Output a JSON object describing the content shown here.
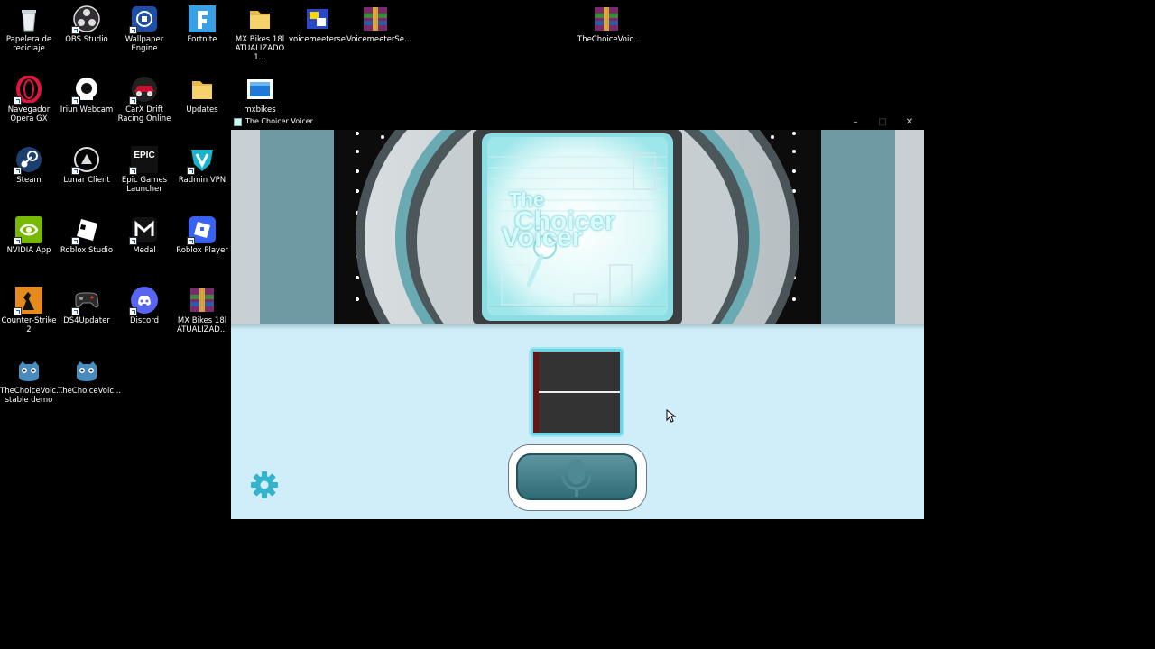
{
  "desktop": {
    "icons": [
      {
        "label": "Papelera de reciclaje",
        "icon": "recycle-bin-icon"
      },
      {
        "label": "OBS Studio",
        "icon": "obs-icon"
      },
      {
        "label": "Wallpaper Engine",
        "icon": "wallpaper-engine-icon"
      },
      {
        "label": "Fortnite",
        "icon": "fortnite-icon"
      },
      {
        "label": "MX Bikes 18l ATUALIZADO 1...",
        "icon": "folder-icon"
      },
      {
        "label": "voicemeeterse...",
        "icon": "voicemeeter-icon"
      },
      {
        "label": "VoicemeeterSe...",
        "icon": "winrar-icon"
      },
      {
        "label": "TheChoiceVoic...",
        "icon": "winrar-icon"
      },
      {
        "label": "Navegador Opera GX",
        "icon": "opera-gx-icon"
      },
      {
        "label": "Iriun Webcam",
        "icon": "iriun-webcam-icon"
      },
      {
        "label": "CarX Drift Racing Online",
        "icon": "carx-icon"
      },
      {
        "label": "Updates",
        "icon": "folder-icon"
      },
      {
        "label": "mxbikes",
        "icon": "mxbikes-icon"
      },
      {
        "label": "Steam",
        "icon": "steam-icon"
      },
      {
        "label": "Lunar Client",
        "icon": "lunar-client-icon"
      },
      {
        "label": "Epic Games Launcher",
        "icon": "epic-games-icon"
      },
      {
        "label": "Radmin VPN",
        "icon": "radmin-vpn-icon"
      },
      {
        "label": "NVIDIA App",
        "icon": "nvidia-icon"
      },
      {
        "label": "Roblox Studio",
        "icon": "roblox-studio-icon"
      },
      {
        "label": "Medal",
        "icon": "medal-icon"
      },
      {
        "label": "Roblox Player",
        "icon": "roblox-player-icon"
      },
      {
        "label": "Counter-Strike 2",
        "icon": "counter-strike-icon"
      },
      {
        "label": "DS4Updater",
        "icon": "gamepad-icon"
      },
      {
        "label": "Discord",
        "icon": "discord-icon"
      },
      {
        "label": "MX Bikes 18l ATUALIZAD...",
        "icon": "winrar-icon"
      },
      {
        "label": "TheChoiceVoic... stable demo",
        "icon": "godot-icon"
      },
      {
        "label": "TheChoiceVoic...",
        "icon": "godot-icon"
      }
    ],
    "epic_text": "EPIC"
  },
  "window": {
    "title": "The Choicer Voicer",
    "minimize": "–",
    "maximize": "□",
    "close": "✕",
    "logo_line1": "The",
    "logo_line2": "Choicer",
    "logo_line3": "Voicer"
  },
  "colors": {
    "panel_bg": "#cfeefa",
    "accent": "#3fb6cc",
    "screen_bg": "#333333",
    "record_button": "#2f6a74"
  }
}
